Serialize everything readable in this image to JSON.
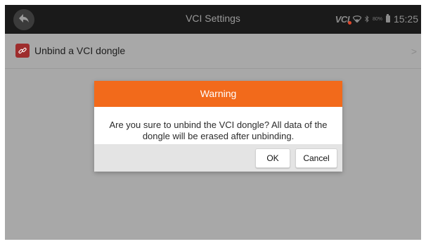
{
  "topbar": {
    "title": "VCI Settings",
    "vci_logo": "VCI",
    "battery_percent": "80%",
    "time": "15:25"
  },
  "list": {
    "items": [
      {
        "label": "Unbind a VCI dongle",
        "icon": "unlink-icon"
      }
    ]
  },
  "dialog": {
    "title": "Warning",
    "message": "Are you sure to unbind the VCI dongle? All data of the dongle will be erased after unbinding.",
    "ok_label": "OK",
    "cancel_label": "Cancel"
  },
  "colors": {
    "accent": "#f26a1b",
    "topbar": "#1a1a1a",
    "dim_background": "#a8a8a8"
  }
}
